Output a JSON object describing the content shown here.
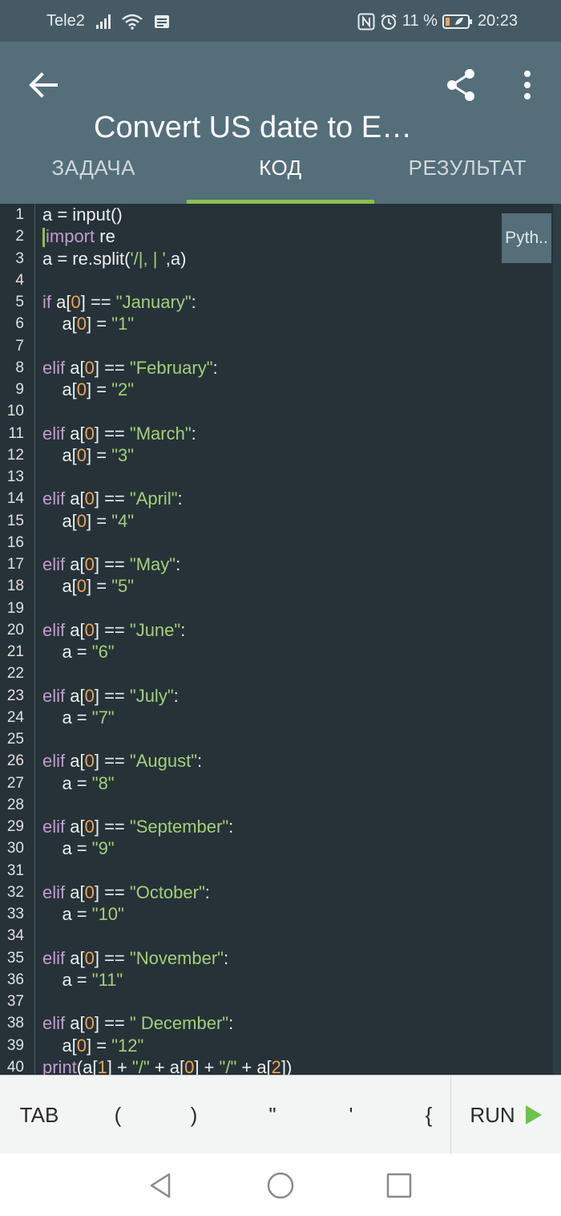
{
  "status_bar": {
    "carrier": "Tele2",
    "battery": "11 %",
    "time": "20:23"
  },
  "app_bar": {
    "title": "Convert US date to European"
  },
  "tabs": [
    {
      "label": "ЗАДАЧА",
      "active": false
    },
    {
      "label": "КОД",
      "active": true
    },
    {
      "label": "РЕЗУЛЬТАТ",
      "active": false
    }
  ],
  "language_label": "Pyth..",
  "code_lines": [
    "a = input()",
    "import re",
    "a = re.split('/|, | ',a)",
    "",
    "if a[0] == \"January\":",
    "    a[0] = \"1\"",
    "",
    "elif a[0] == \"February\":",
    "    a[0] = \"2\"",
    "",
    "elif a[0] == \"March\":",
    "    a[0] = \"3\"",
    "",
    "elif a[0] == \"April\":",
    "    a[0] = \"4\"",
    "",
    "elif a[0] == \"May\":",
    "    a[0] = \"5\"",
    "",
    "elif a[0] == \"June\":",
    "    a = \"6\"",
    "",
    "elif a[0] == \"July\":",
    "    a = \"7\"",
    "",
    "elif a[0] == \"August\":",
    "    a = \"8\"",
    "",
    "elif a[0] == \"September\":",
    "    a = \"9\"",
    "",
    "elif a[0] == \"October\":",
    "    a = \"10\"",
    "",
    "elif a[0] == \"November\":",
    "    a = \"11\"",
    "",
    "elif a[0] == \" December\":",
    "    a[0] = \"12\"",
    "print(a[1] + \"/\" + a[0] + \"/\" + a[2])"
  ],
  "cursor_line": 2,
  "keys": [
    "TAB",
    "(",
    ")",
    "\"",
    "'",
    "{"
  ],
  "run_label": "RUN",
  "colors": {
    "status_bar": "#455a64",
    "app_bar": "#546e7a",
    "editor_bg": "#263238",
    "accent": "#8bc34a",
    "keyword": "#c49ad2",
    "string": "#a5cf7a",
    "number": "#f0a252"
  },
  "icons": [
    "signal-icon",
    "wifi-icon",
    "message-icon",
    "nfc-icon",
    "alarm-icon",
    "battery-icon",
    "back-arrow-icon",
    "share-icon",
    "more-vert-icon",
    "play-icon",
    "nav-back-icon",
    "nav-home-icon",
    "nav-recents-icon"
  ]
}
